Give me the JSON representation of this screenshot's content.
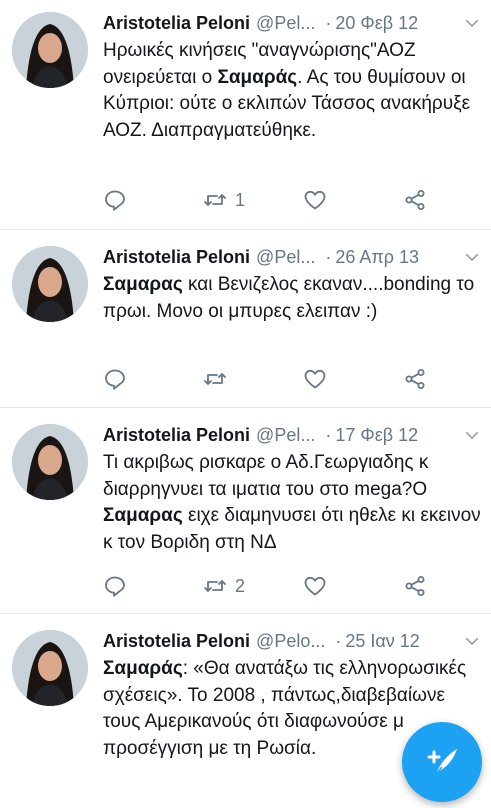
{
  "tweets": [
    {
      "name": "Aristotelia Peloni",
      "handle": "@Pel...",
      "sep": "·",
      "date": "20 Φεβ 12",
      "text": [
        {
          "t": "Ηρωικές κινήσεις \"αναγνώρισης\"ΑΟΖ ονειρεύεται ο "
        },
        {
          "b": "Σαμαράς"
        },
        {
          "t": ". Ας του θυμίσουν οι Κύπριοι: ούτε ο εκλιπών Τάσσος ανακήρυξε ΑΟΖ. Διαπραγματεύθηκε."
        }
      ],
      "retweets": "1"
    },
    {
      "name": "Aristotelia Peloni",
      "handle": "@Pel...",
      "sep": "·",
      "date": "26 Απρ 13",
      "text": [
        {
          "b": "Σαμαρας"
        },
        {
          "t": " και Βενιζελος εκαναν....bonding το πρωι. Μονο οι μπυρες ελειπαν :)"
        }
      ],
      "retweets": ""
    },
    {
      "name": "Aristotelia Peloni",
      "handle": "@Pel...",
      "sep": "·",
      "date": "17 Φεβ 12",
      "text": [
        {
          "t": "Τι ακριβως ρισκαρε ο Αδ.Γεωργιαδης κ διαρρηγνυει τα ιματια του στο mega?Ο "
        },
        {
          "b": "Σαμαρας"
        },
        {
          "t": " ειχε διαμηνυσει ότι ηθελε κι εκεινον κ τον Βοριδη στη ΝΔ"
        }
      ],
      "retweets": "2"
    },
    {
      "name": "Aristotelia Peloni",
      "handle": "@Pelo...",
      "sep": "·",
      "date": "25 Ιαν 12",
      "text": [
        {
          "b": "Σαμαράς"
        },
        {
          "t": ": «Θα ανατάξω τις ελληνορωσικές σχέσεις». Το 2008 , πάντως,διαβεβαίωνε τους Αμερικανούς ότι διαφωνούσε μ προσέγγιση με τη Ρωσία."
        }
      ],
      "retweets": ""
    }
  ],
  "icons": {
    "reply": "reply-icon",
    "retweet": "retweet-icon",
    "like": "heart-icon",
    "share": "share-icon",
    "more": "chevron-down-icon",
    "compose": "compose-tweet-icon"
  },
  "colors": {
    "accent": "#1da1f2",
    "secondary_text": "#657786",
    "divider": "#e1e8ed",
    "icon": "#657786"
  }
}
